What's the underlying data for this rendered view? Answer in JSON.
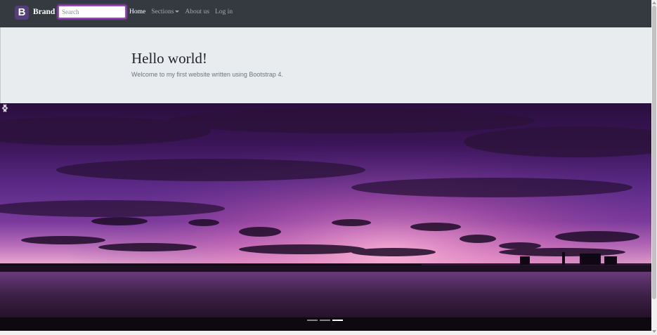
{
  "navbar": {
    "brand_logo": "B",
    "brand_text": "Brand",
    "search_placeholder": "Search",
    "links": [
      {
        "label": "Home",
        "active": true
      },
      {
        "label": "Sections",
        "dropdown": true
      },
      {
        "label": "About us"
      },
      {
        "label": "Log in"
      }
    ]
  },
  "jumbotron": {
    "title": "Hello world!",
    "lead": "Welcome to my first website written using Bootstrap 4."
  },
  "carousel": {
    "prev_icon": "chevron-left-icon",
    "next_icon": "chevron-right-icon",
    "slide_count": 3,
    "active_slide": 3
  },
  "colors": {
    "navbar_bg": "#343a40",
    "brand_logo_bg": "#563d7c",
    "jumbotron_bg": "#e9ecef",
    "search_focus": "#a046c0"
  }
}
